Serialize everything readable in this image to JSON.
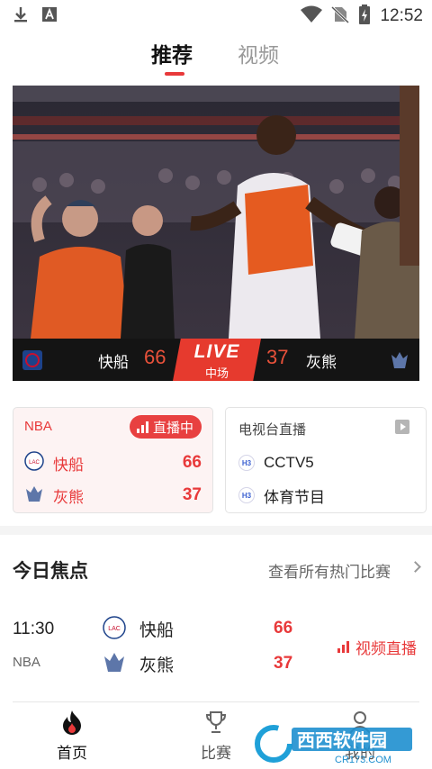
{
  "status_bar": {
    "time": "12:52"
  },
  "top_tabs": {
    "recommended": "推荐",
    "video": "视频"
  },
  "hero": {
    "home_team": "快船",
    "home_score": "66",
    "away_team": "灰熊",
    "away_score": "37",
    "live_label": "LIVE",
    "period": "中场"
  },
  "live_card": {
    "league": "NBA",
    "badge": "直播中",
    "teams": [
      {
        "name": "快船",
        "score": "66",
        "logo": "clippers-logo"
      },
      {
        "name": "灰熊",
        "score": "37",
        "logo": "grizzlies-logo"
      }
    ]
  },
  "tv_card": {
    "title": "电视台直播",
    "channels": [
      {
        "name": "CCTV5"
      },
      {
        "name": "体育节目"
      }
    ]
  },
  "focus": {
    "title": "今日焦点",
    "more": "查看所有热门比赛",
    "match": {
      "time": "11:30",
      "league": "NBA",
      "teams": [
        {
          "name": "快船",
          "score": "66"
        },
        {
          "name": "灰熊",
          "score": "37"
        }
      ],
      "action": "视频直播"
    }
  },
  "bottom_nav": {
    "home": "首页",
    "matches": "比赛",
    "mine": "我的"
  },
  "watermark": {
    "brand": "西西软件园",
    "site": "CR173.COM"
  },
  "colors": {
    "accent": "#e8393a",
    "live_bg": "#e63a2e",
    "card_tint": "#fdf3f3"
  }
}
